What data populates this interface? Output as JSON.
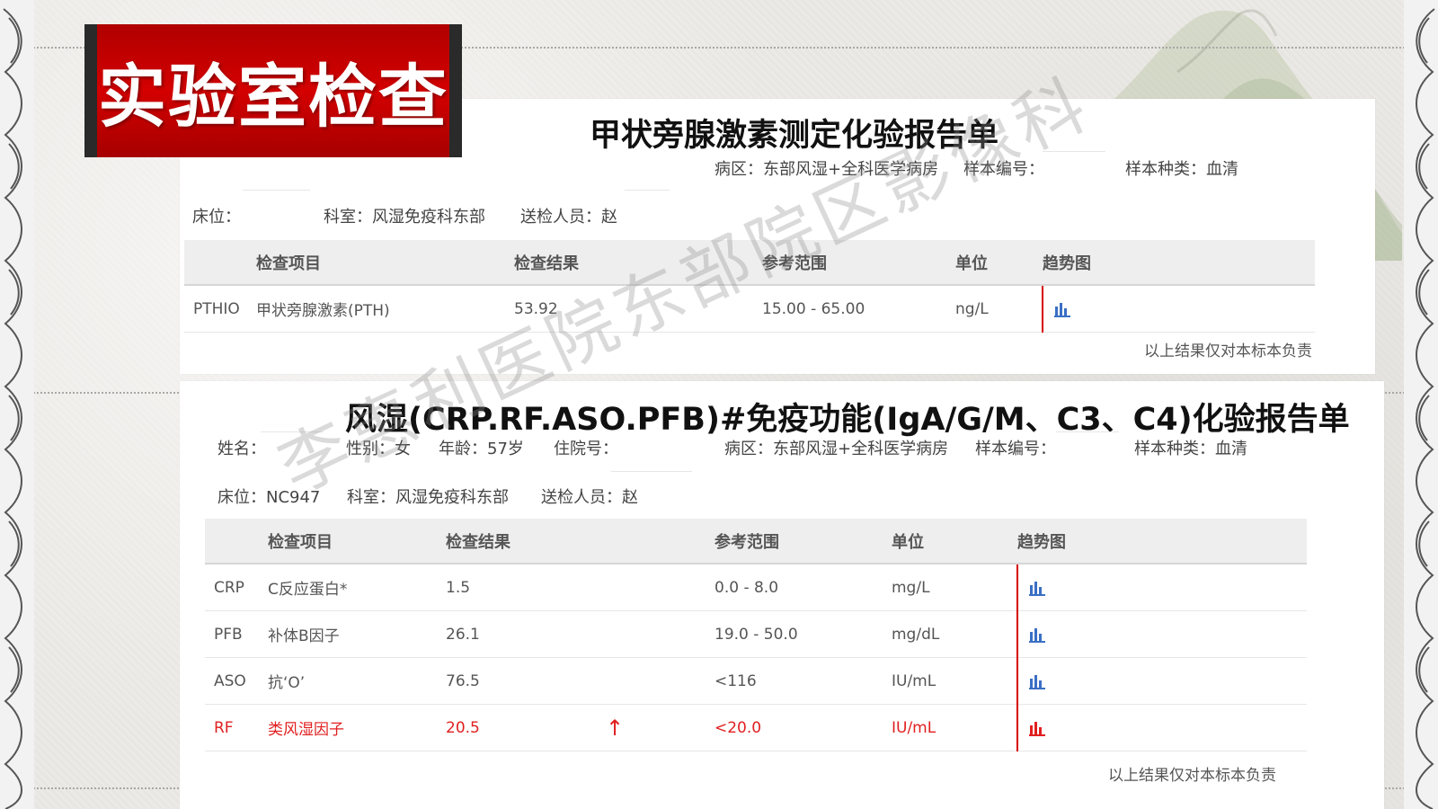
{
  "slide_title": "实验室检查",
  "watermark": "李惠利医院东部院区影像科",
  "report1": {
    "title": "甲状旁腺激素测定化验报告单",
    "fields": {
      "ward": "病区：东部风湿+全科医学病房",
      "sample_no": "样本编号：",
      "sample_type": "样本种类：血清",
      "bed": "床位：",
      "dept": "科室：风湿免疫科东部",
      "sender": "送检人员：赵"
    },
    "headers": [
      "检查项目",
      "检查结果",
      "参考范围",
      "单位",
      "趋势图"
    ],
    "rows": [
      {
        "code": "PTHIO",
        "name": "甲状旁腺激素(PTH)",
        "result": "53.92",
        "flag": "",
        "range": "15.00 - 65.00",
        "unit": "ng/L"
      }
    ],
    "footer": "以上结果仅对本标本负责"
  },
  "report2": {
    "title": "风湿(CRP.RF.ASO.PFB)#免疫功能(IgA/G/M、C3、C4)化验报告单",
    "fields": {
      "name": "姓名：",
      "sex": "性别：女",
      "age": "年龄：57岁",
      "inpatient_no": "住院号：",
      "ward": "病区：东部风湿+全科医学病房",
      "sample_no": "样本编号：",
      "sample_type": "样本种类：血清",
      "bed": "床位：NC947",
      "dept": "科室：风湿免疫科东部",
      "sender": "送检人员：赵"
    },
    "headers": [
      "检查项目",
      "检查结果",
      "参考范围",
      "单位",
      "趋势图"
    ],
    "rows": [
      {
        "code": "CRP",
        "name": "C反应蛋白*",
        "result": "1.5",
        "flag": "",
        "range": "0.0 - 8.0",
        "unit": "mg/L"
      },
      {
        "code": "PFB",
        "name": "补体B因子",
        "result": "26.1",
        "flag": "",
        "range": "19.0 - 50.0",
        "unit": "mg/dL"
      },
      {
        "code": "ASO",
        "name": "抗‘O’",
        "result": "76.5",
        "flag": "",
        "range": "<116",
        "unit": "IU/mL"
      },
      {
        "code": "RF",
        "name": "类风湿因子",
        "result": "20.5",
        "flag": "↑",
        "range": "<20.0",
        "unit": "IU/mL"
      }
    ],
    "footer": "以上结果仅对本标本负责"
  },
  "colors": {
    "title_red": "#c00000",
    "abnormal_red": "#e11f1f",
    "trend_red": "#d80000"
  }
}
